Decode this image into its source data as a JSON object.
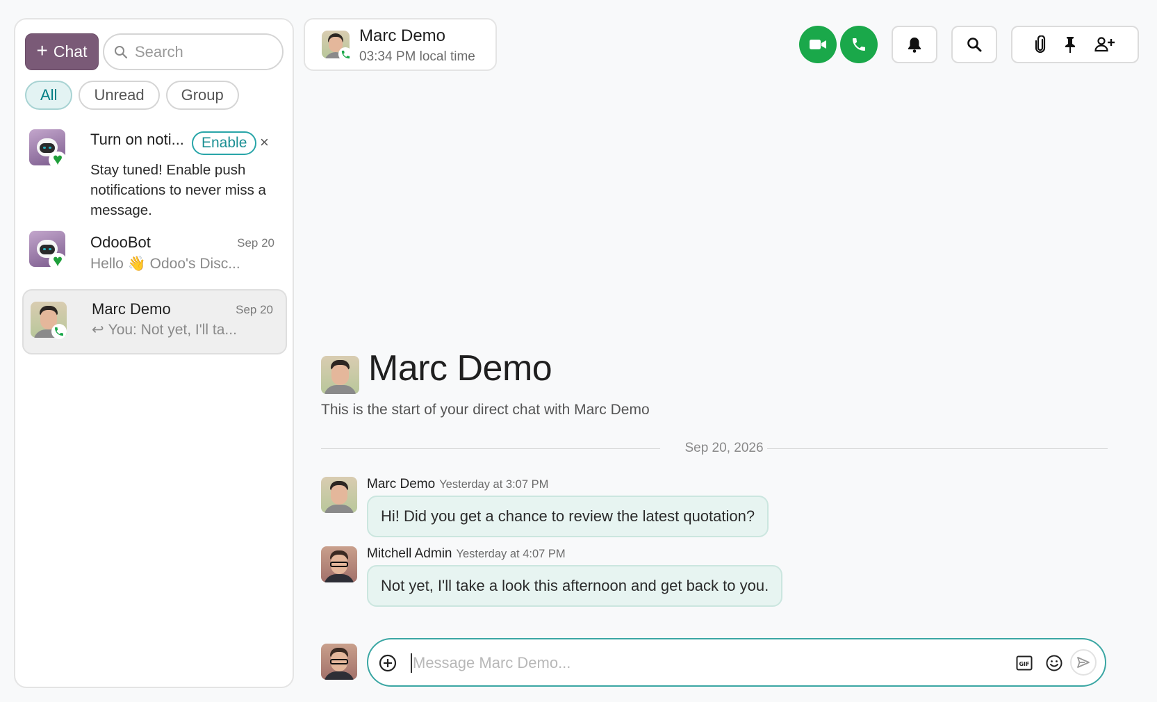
{
  "sidebar": {
    "new_chat_label": "Chat",
    "search_placeholder": "Search",
    "filters": [
      "All",
      "Unread",
      "Group"
    ],
    "notification": {
      "title": "Turn on noti...",
      "enable_label": "Enable",
      "close_label": "×",
      "text": "Stay tuned! Enable push notifications to never miss a message."
    },
    "conversations": [
      {
        "name": "OdooBot",
        "date": "Sep 20",
        "preview": "Hello 👋 Odoo's Disc..."
      },
      {
        "name": "Marc Demo",
        "date": "Sep 20",
        "preview": "You: Not yet, I'll ta...",
        "reply_icon": "↩"
      }
    ]
  },
  "header": {
    "name": "Marc Demo",
    "local_time": "03:34 PM local time"
  },
  "thread": {
    "title": "Marc Demo",
    "intro": "This is the start of your direct chat with Marc Demo",
    "date_separator": "Sep 20, 2026",
    "messages": [
      {
        "author": "Marc Demo",
        "time": "Yesterday at 3:07 PM",
        "text": "Hi! Did you get a chance to review the latest quotation?"
      },
      {
        "author": "Mitchell Admin",
        "time": "Yesterday at 4:07 PM",
        "text": "Not yet, I'll take a look this afternoon and get back to you."
      }
    ]
  },
  "composer": {
    "placeholder": "Message Marc Demo...",
    "gif_label": "GIF"
  },
  "colors": {
    "brand": "#7a5a77",
    "call_green": "#1aa84a",
    "accent_teal": "#017e84",
    "bubble_bg": "#e7f4f1"
  }
}
